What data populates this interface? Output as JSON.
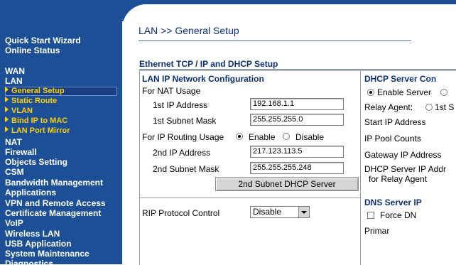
{
  "sidebar": {
    "top_links": [
      "Quick Start Wizard",
      "Online Status"
    ],
    "items": [
      "WAN",
      "LAN"
    ],
    "lan_sub": [
      "General Setup",
      "Static Route",
      "VLAN",
      "Bind IP to MAC",
      "LAN Port Mirror"
    ],
    "items2": [
      "NAT",
      "Firewall",
      "Objects Setting",
      "CSM",
      "Bandwidth Management",
      "Applications",
      "VPN and Remote Access",
      "Certificate Management",
      "VoIP",
      "Wireless LAN",
      "USB Application",
      "System Maintenance",
      "Diagnostics"
    ]
  },
  "page": {
    "title": "LAN >> General Setup",
    "section_title": "Ethernet TCP / IP and DHCP Setup"
  },
  "lan_ip": {
    "header": "LAN IP Network Configuration",
    "nat_usage": "For NAT Usage",
    "ip1_label": "1st IP Address",
    "ip1_value": "192.168.1.1",
    "mask1_label": "1st Subnet Mask",
    "mask1_value": "255.255.255.0",
    "routing_label": "For IP Routing Usage",
    "enable_label": "Enable",
    "disable_label": "Disable",
    "ip2_label": "2nd IP Address",
    "ip2_value": "217.123.113.5",
    "mask2_label": "2nd Subnet Mask",
    "mask2_value": "255.255.255.248",
    "dhcp2_button": "2nd Subnet DHCP Server",
    "rip_label": "RIP Protocol Control",
    "rip_value": "Disable"
  },
  "dhcp": {
    "header": "DHCP Server Con",
    "enable_server": "Enable Server",
    "relay_agent": "Relay Agent:",
    "relay_option": "1st S",
    "start_ip": "Start IP Address",
    "pool_counts": "IP Pool Counts",
    "gateway_ip": "Gateway IP Address",
    "server_ip_line1": "DHCP Server IP Addr",
    "server_ip_line2": "for Relay Agent"
  },
  "dns": {
    "header": "DNS Server IP",
    "force": "Force DN",
    "primary": "Primar"
  }
}
